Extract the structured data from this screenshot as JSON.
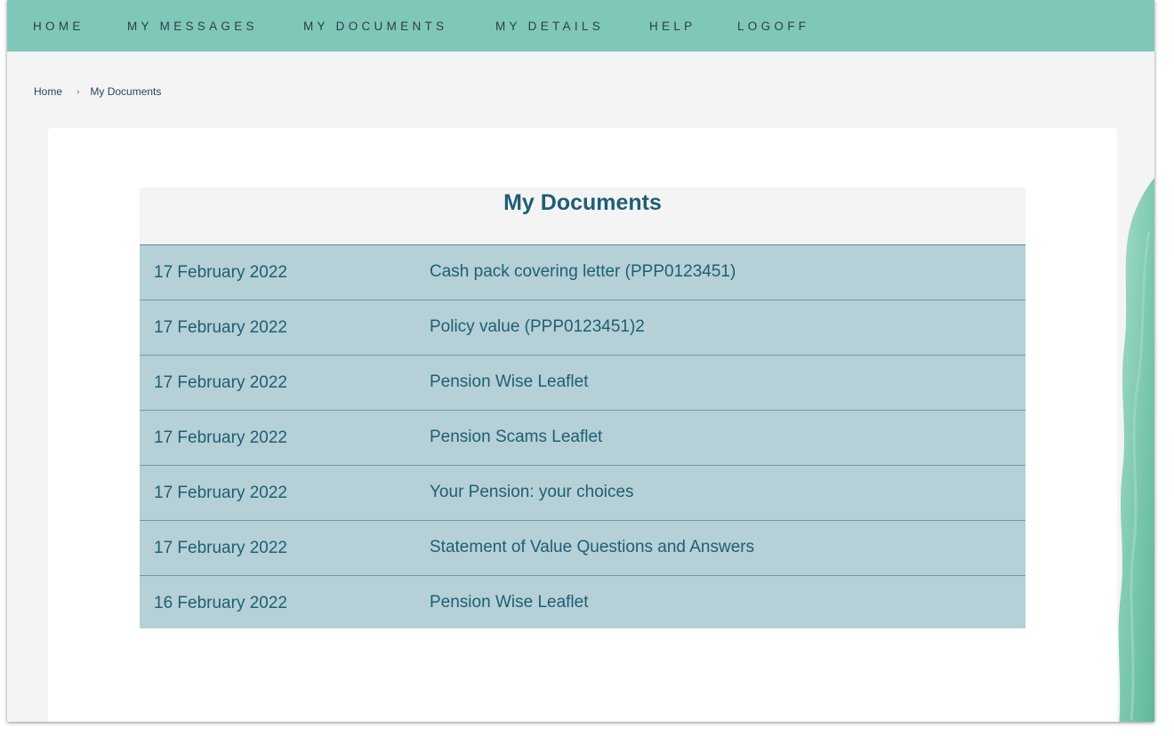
{
  "nav": {
    "items": [
      {
        "label": "HOME"
      },
      {
        "label": "MY MESSAGES"
      },
      {
        "label": "MY DOCUMENTS"
      },
      {
        "label": "MY DETAILS"
      },
      {
        "label": "HELP"
      },
      {
        "label": "LOGOFF"
      }
    ]
  },
  "breadcrumb": {
    "home": "Home",
    "separator": "›",
    "current": "My Documents"
  },
  "documents": {
    "title": "My Documents",
    "rows": [
      {
        "date": "17 February 2022",
        "name": "Cash pack covering letter (PPP0123451)"
      },
      {
        "date": "17 February 2022",
        "name": "Policy value (PPP0123451)2"
      },
      {
        "date": "17 February 2022",
        "name": "Pension Wise Leaflet"
      },
      {
        "date": "17 February 2022",
        "name": "Pension Scams Leaflet"
      },
      {
        "date": "17 February 2022",
        "name": "Your Pension: your choices"
      },
      {
        "date": "17 February 2022",
        "name": "Statement of Value Questions and Answers"
      },
      {
        "date": "16 February 2022",
        "name": "Pension Wise Leaflet"
      }
    ]
  },
  "colors": {
    "nav_bg": "#7fc8b9",
    "row_bg": "#b5d0d6",
    "text_accent": "#1d5f75",
    "page_bg": "#f4f4f4"
  }
}
